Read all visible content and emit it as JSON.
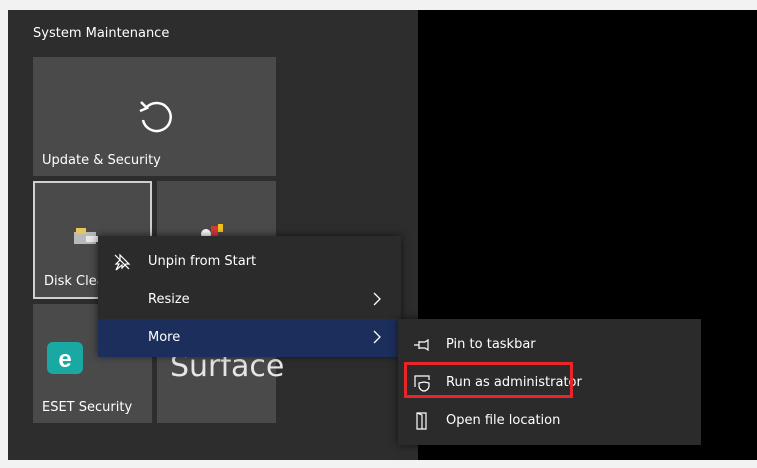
{
  "start_menu": {
    "group_title": "System Maintenance",
    "tiles": {
      "update_security": "Update & Security",
      "disk_cleanup": "Disk Clea",
      "eset_security": "ESET Security",
      "surface": "Surface"
    }
  },
  "context_menu": {
    "unpin": "Unpin from Start",
    "resize": "Resize",
    "more": "More"
  },
  "submenu": {
    "pin_taskbar": "Pin to taskbar",
    "run_admin": "Run as administrator",
    "open_location": "Open file location"
  },
  "colors": {
    "highlight": "#1c2e5c",
    "annotation": "#e8262a",
    "eset": "#1aa8a3"
  }
}
